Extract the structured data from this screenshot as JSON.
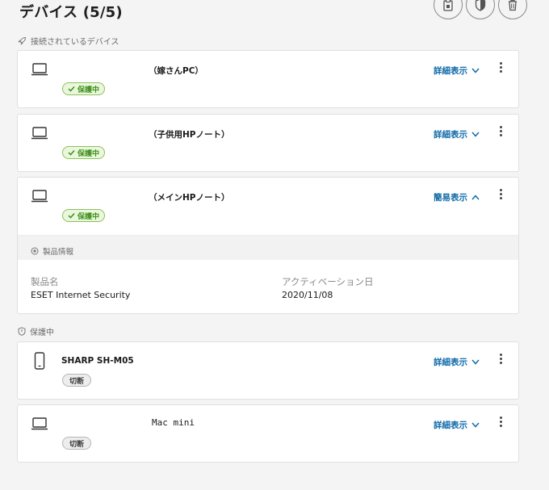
{
  "header": {
    "title": "デバイス (5/5)"
  },
  "top_actions": [
    {
      "icon": "clipboard-icon"
    },
    {
      "icon": "shield-icon"
    },
    {
      "icon": "trash-icon"
    }
  ],
  "sections": {
    "connected": {
      "icon": "rocket-icon",
      "label": "接続されているデバイス"
    },
    "protected": {
      "icon": "shield-icon",
      "label": "保護中"
    }
  },
  "devices": [
    {
      "icon": "laptop-icon",
      "name": "（嫁さんPC）",
      "status": "保護中",
      "status_type": "protected",
      "toggle_label": "詳細表示",
      "expanded": false
    },
    {
      "icon": "laptop-icon",
      "name": "（子供用HPノート）",
      "status": "保護中",
      "status_type": "protected",
      "toggle_label": "詳細表示",
      "expanded": false
    },
    {
      "icon": "laptop-icon",
      "name": "（メインHPノート）",
      "status": "保護中",
      "status_type": "protected",
      "toggle_label": "簡易表示",
      "expanded": true,
      "product_info": {
        "heading": "製品情報",
        "product_label": "製品名",
        "product_value": "ESET Internet Security",
        "activation_label": "アクティベーション日",
        "activation_value": "2020/11/08"
      }
    },
    {
      "icon": "phone-icon",
      "name": "SHARP SH-M05",
      "status": "切断",
      "status_type": "disconnected",
      "toggle_label": "詳細表示",
      "expanded": false
    },
    {
      "icon": "laptop-icon",
      "name": "Mac mini",
      "status": "切断",
      "status_type": "disconnected",
      "toggle_label": "詳細表示",
      "expanded": false
    }
  ],
  "colors": {
    "accent": "#0f6aa8",
    "protected_green": "#3f8f1b",
    "background": "#f4f4f5"
  }
}
